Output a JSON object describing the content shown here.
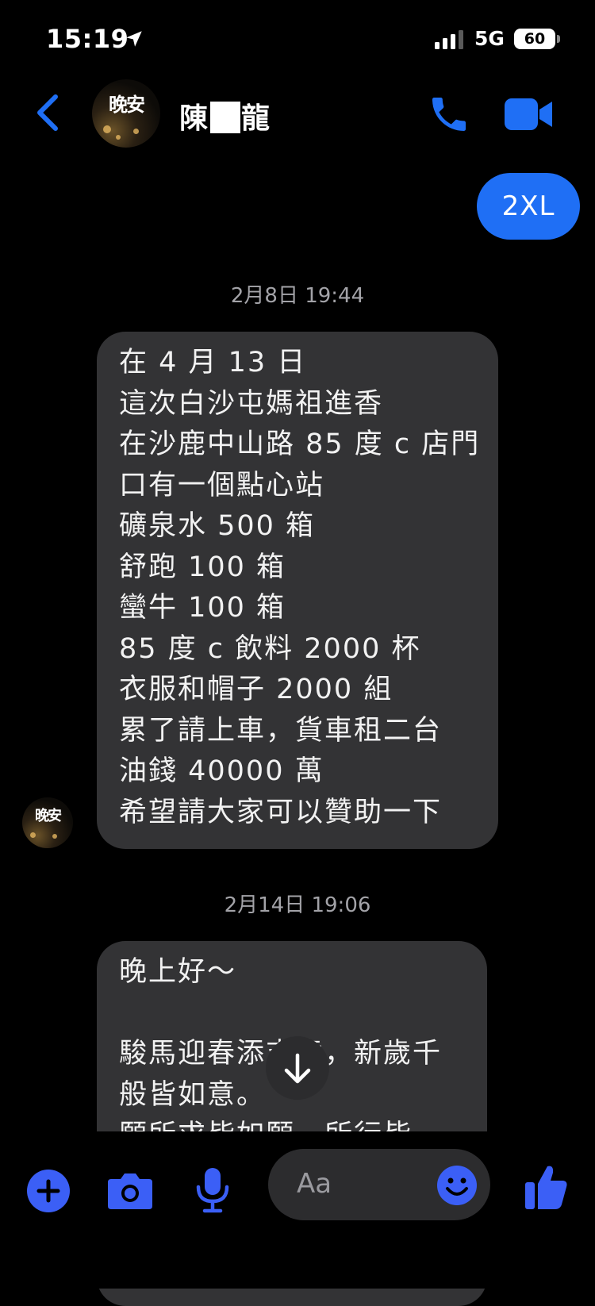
{
  "status_bar": {
    "time": "15:19",
    "network": "5G",
    "battery": "60"
  },
  "header": {
    "avatar_text": "晚安",
    "contact_name_first": "陳",
    "contact_name_last": "龍"
  },
  "icons": {
    "back": "chevron-left-icon",
    "call": "phone-icon",
    "video": "video-camera-icon",
    "add": "plus-icon",
    "camera": "camera-icon",
    "mic": "microphone-icon",
    "emoji": "smiley-icon",
    "like": "thumbs-up-icon",
    "scroll_down": "arrow-down-icon"
  },
  "colors": {
    "accent": "#1f6ff5",
    "icon_blue": "#3b5ff6",
    "received_bubble": "#333335"
  },
  "messages": {
    "sent_1": "2XL",
    "timestamp_1": "2月8日 19:44",
    "received_1_lines": [
      "在 4 月 13 日",
      "這次白沙屯媽祖進香",
      "在沙鹿中山路 85 度 c 店門",
      "口有一個點心站",
      "礦泉水 500 箱",
      "舒跑 100 箱",
      "蠻牛 100 箱",
      "85 度 c 飲料 2000 杯",
      "衣服和帽子 2000 組",
      "累了請上車，貨車租二台",
      "油錢 40000 萬",
      "希望請大家可以贊助一下"
    ],
    "timestamp_2": "2月14日 19:06",
    "received_2_lines": [
      "晚上好～",
      "",
      "駿馬迎春添吉意，新歲千",
      "般皆如意。",
      "願所求皆如願，所行皆"
    ]
  },
  "composer": {
    "placeholder": "Aa"
  }
}
